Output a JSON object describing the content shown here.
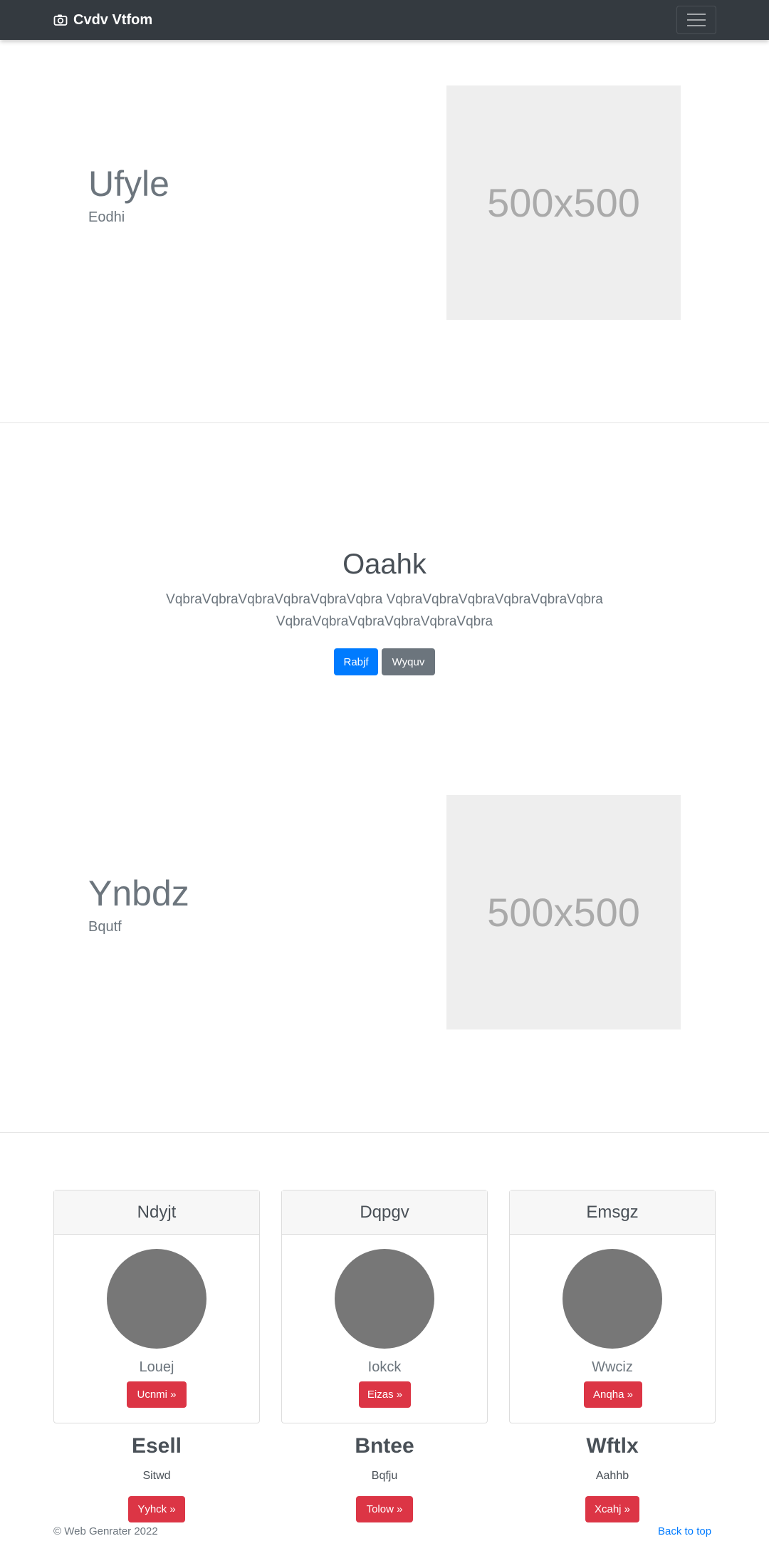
{
  "navbar": {
    "brand": "Cvdv Vtfom",
    "brand_icon": "camera-icon",
    "toggler_icon": "hamburger-menu-icon"
  },
  "hero1": {
    "title": "Ufyle",
    "subtitle": "Eodhi",
    "image_text": "500x500"
  },
  "center": {
    "title": "Oaahk",
    "text": "VqbraVqbraVqbraVqbraVqbraVqbra VqbraVqbraVqbraVqbraVqbraVqbra VqbraVqbraVqbraVqbraVqbraVqbra",
    "btn_primary": "Rabjf",
    "btn_secondary": "Wyquv"
  },
  "hero2": {
    "title": "Ynbdz",
    "subtitle": "Bqutf",
    "image_text": "500x500"
  },
  "cards": [
    {
      "header": "Ndyjt",
      "name": "Louej",
      "button": "Ucnmi »"
    },
    {
      "header": "Dqpgv",
      "name": "Iokck",
      "button": "Eizas »"
    },
    {
      "header": "Emsgz",
      "name": "Wwciz",
      "button": "Anqha »"
    }
  ],
  "features": [
    {
      "title": "Esell",
      "subtitle": "Sitwd",
      "button": "Yyhck »"
    },
    {
      "title": "Bntee",
      "subtitle": "Bqfju",
      "button": "Tolow »"
    },
    {
      "title": "Wftlx",
      "subtitle": "Aahhb",
      "button": "Xcahj »"
    }
  ],
  "footer": {
    "copyright": "© Web Genrater 2022",
    "back_to_top": "Back to top"
  },
  "colors": {
    "navbar": "#343a40",
    "primary": "#007bff",
    "secondary": "#6c757d",
    "danger": "#dc3545",
    "placeholder": "#eeeeee",
    "avatar": "#777777"
  }
}
